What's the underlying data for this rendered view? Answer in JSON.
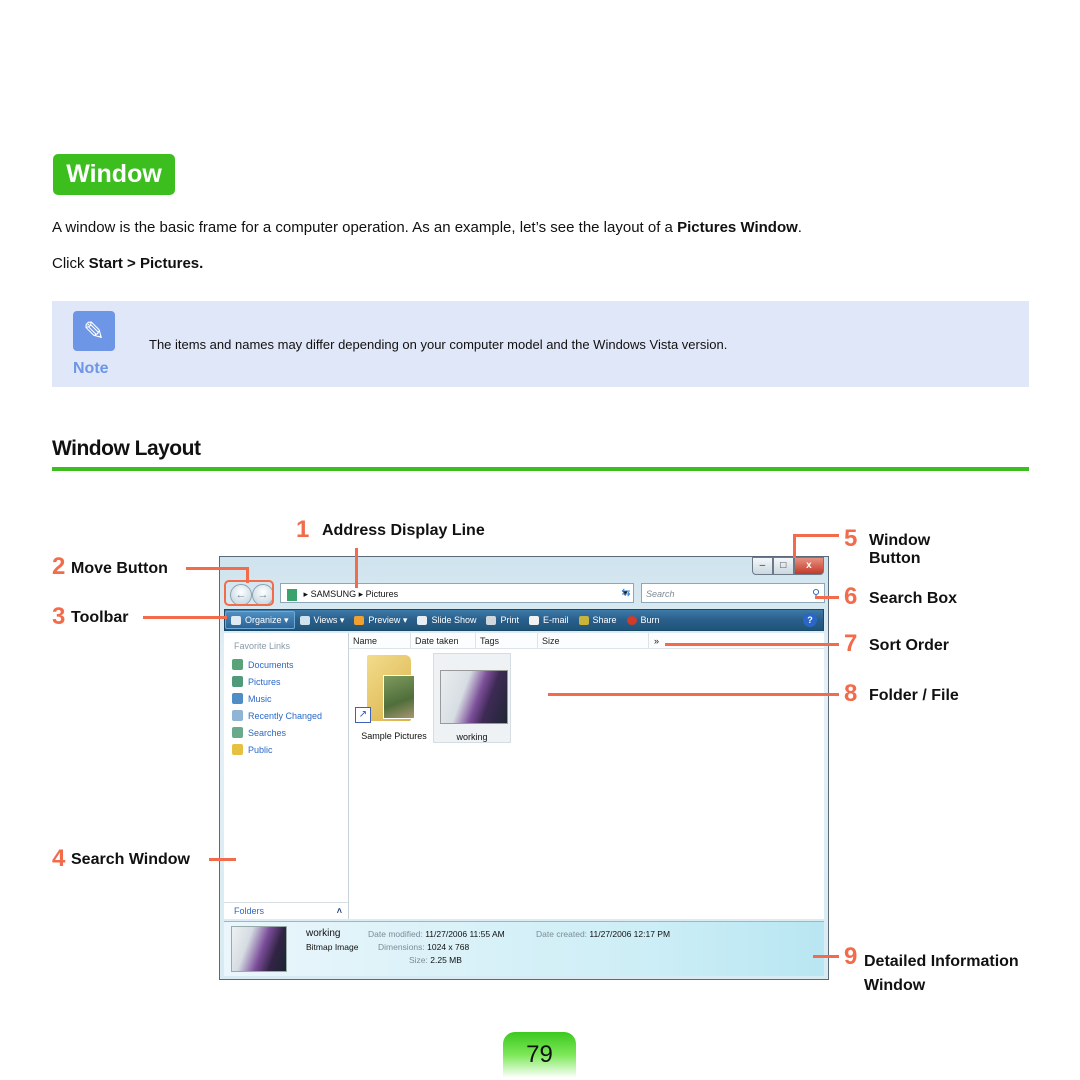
{
  "header": {
    "title": "Window",
    "intro_prefix": "A window is the basic frame for a computer operation. As an example, let’s see the layout of a ",
    "intro_bold": "Pictures Window",
    "intro_suffix": ".",
    "step_prefix": "Click ",
    "step_bold": "Start > Pictures."
  },
  "note": {
    "icon": "pencil-icon",
    "label": "Note",
    "text": "The items and names may differ depending on your computer model and the Windows Vista version."
  },
  "section": {
    "title": "Window Layout"
  },
  "callouts": [
    {
      "num": "1",
      "label": "Address Display Line"
    },
    {
      "num": "2",
      "label": "Move Button"
    },
    {
      "num": "3",
      "label": "Toolbar"
    },
    {
      "num": "4",
      "label": "Search Window"
    },
    {
      "num": "5",
      "label": "Window",
      "label2": "Button"
    },
    {
      "num": "6",
      "label": "Search Box"
    },
    {
      "num": "7",
      "label": "Sort Order"
    },
    {
      "num": "8",
      "label": "Folder / File"
    },
    {
      "num": "9",
      "label": "Detailed Information",
      "label2": "Window"
    }
  ],
  "explorer": {
    "window_buttons": {
      "minimize": "–",
      "maximize": "□",
      "close": "x"
    },
    "nav": {
      "back": "←",
      "forward": "→"
    },
    "address": [
      "SAMSUNG",
      "Pictures"
    ],
    "address_sep": "▸",
    "search_placeholder": "Search",
    "toolbar": [
      {
        "label": "Organize ▾",
        "icon": "organize-icon"
      },
      {
        "label": "Views ▾",
        "icon": "views-icon"
      },
      {
        "label": "Preview ▾",
        "icon": "preview-icon"
      },
      {
        "label": "Slide Show",
        "icon": "slideshow-icon"
      },
      {
        "label": "Print",
        "icon": "print-icon"
      },
      {
        "label": "E-mail",
        "icon": "email-icon"
      },
      {
        "label": "Share",
        "icon": "share-icon"
      },
      {
        "label": "Burn",
        "icon": "burn-icon"
      }
    ],
    "help": "?",
    "favorite_links_title": "Favorite Links",
    "favorite_links": [
      "Documents",
      "Pictures",
      "Music",
      "Recently Changed",
      "Searches",
      "Public"
    ],
    "folders_label": "Folders",
    "folders_chevron": "˄",
    "columns": [
      "Name",
      "Date taken",
      "Tags",
      "Size"
    ],
    "more_columns": "»",
    "items": [
      {
        "name": "Sample Pictures",
        "type": "folder"
      },
      {
        "name": "working",
        "type": "image"
      }
    ],
    "details": {
      "name": "working",
      "type": "Bitmap Image",
      "date_modified_label": "Date modified:",
      "date_modified": "11/27/2006 11:55 AM",
      "date_created_label": "Date created:",
      "date_created": "11/27/2006 12:17 PM",
      "dimensions_label": "Dimensions:",
      "dimensions": "1024 x 768",
      "size_label": "Size:",
      "size": "2.25 MB"
    }
  },
  "page_number": "79",
  "colors": {
    "accent_green": "#3cbf1e",
    "callout_orange": "#f26b4a",
    "note_blue": "#6e96e6",
    "note_bg": "#e0e7f8"
  }
}
